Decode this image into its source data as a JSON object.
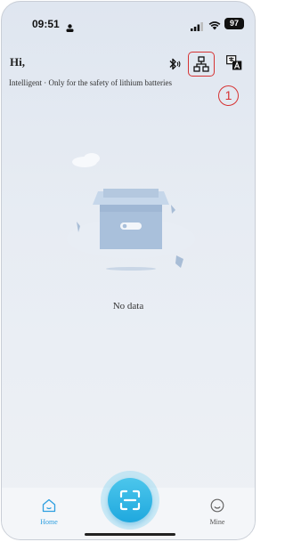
{
  "status_bar": {
    "time": "09:51",
    "battery": "97"
  },
  "header": {
    "greeting": "Hi,",
    "subtitle": "Intelligent · Only for the safety of lithium batteries",
    "icons": [
      "bluetooth-icon",
      "network-icon",
      "translate-icon"
    ]
  },
  "annotation": {
    "badge": "1",
    "color": "#d63333"
  },
  "main": {
    "empty_text": "No data"
  },
  "tab_bar": {
    "home_label": "Home",
    "mine_label": "Mine",
    "active_color": "#2d9fe0",
    "scan_icon": "scan-icon"
  }
}
